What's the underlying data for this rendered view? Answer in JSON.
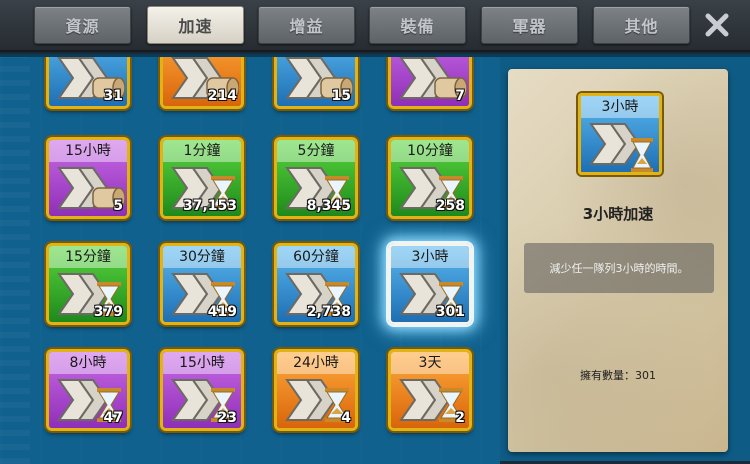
{
  "tabs": [
    {
      "label": "資源",
      "active": false
    },
    {
      "label": "加速",
      "active": true
    },
    {
      "label": "增益",
      "active": false
    },
    {
      "label": "裝備",
      "active": false
    },
    {
      "label": "軍器",
      "active": false
    },
    {
      "label": "其他",
      "active": false
    }
  ],
  "close_icon": "close-icon",
  "items_row0": [
    {
      "label": "",
      "count": "31",
      "color": "blue",
      "type": "scroll"
    },
    {
      "label": "",
      "count": "214",
      "color": "orange",
      "type": "scroll"
    },
    {
      "label": "",
      "count": "15",
      "color": "blue",
      "type": "scroll"
    },
    {
      "label": "",
      "count": "7",
      "color": "purple",
      "type": "scroll"
    }
  ],
  "items": [
    {
      "label": "15小時",
      "count": "5",
      "color": "purple",
      "type": "scroll"
    },
    {
      "label": "1分鐘",
      "count": "37,153",
      "color": "green",
      "type": "hourglass"
    },
    {
      "label": "5分鐘",
      "count": "8,345",
      "color": "green",
      "type": "hourglass"
    },
    {
      "label": "10分鐘",
      "count": "258",
      "color": "green",
      "type": "hourglass"
    },
    {
      "label": "15分鐘",
      "count": "379",
      "color": "green",
      "type": "hourglass"
    },
    {
      "label": "30分鐘",
      "count": "419",
      "color": "blue",
      "type": "hourglass"
    },
    {
      "label": "60分鐘",
      "count": "2,738",
      "color": "blue",
      "type": "hourglass"
    },
    {
      "label": "3小時",
      "count": "301",
      "color": "blue",
      "type": "hourglass",
      "selected": true
    },
    {
      "label": "8小時",
      "count": "47",
      "color": "purple",
      "type": "hourglass"
    },
    {
      "label": "15小時",
      "count": "23",
      "color": "purple",
      "type": "hourglass"
    },
    {
      "label": "24小時",
      "count": "4",
      "color": "orange",
      "type": "hourglass"
    },
    {
      "label": "3天",
      "count": "2",
      "color": "orange",
      "type": "hourglass"
    }
  ],
  "detail": {
    "icon_label": "3小時",
    "title": "3小時加速",
    "description": "減少任一隊列3小時的時間。",
    "owned": "擁有數量：301"
  }
}
